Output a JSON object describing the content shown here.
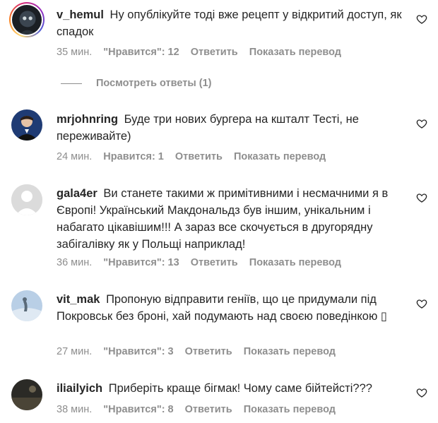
{
  "comments": [
    {
      "username": "v_hemul",
      "text": "Ну опублікуйте тоді вже рецепт у відкритий доступ, як спадок",
      "time": "35 мин.",
      "likes": "\"Нравится\": 12",
      "reply": "Ответить",
      "translate": "Показать перевод",
      "replies": "Посмотреть ответы (1)"
    },
    {
      "username": "mrjohnring",
      "text": "Буде три нових бургера на кшталт Тесті, не переживайте)",
      "time": "24 мин.",
      "likes": "Нравится: 1",
      "reply": "Ответить",
      "translate": "Показать перевод"
    },
    {
      "username": "gala4er",
      "text": "Ви станете такими ж примітивними і несмачними я в Європі! Український Макдональдз був іншим, унікальним і набагато цікавішим!!! А зараз все скочується в другорядну забігалівку як у Польщі наприклад!",
      "time": "36 мин.",
      "likes": "\"Нравится\": 13",
      "reply": "Ответить",
      "translate": "Показать перевод"
    },
    {
      "username": "vit_mak",
      "text": "Пропоную відправити геніїв, що це придумали під Покровськ без броні, хай подумають над своєю поведінкою ▯",
      "time": "27 мин.",
      "likes": "\"Нравится\": 3",
      "reply": "Ответить",
      "translate": "Показать перевод"
    },
    {
      "username": "iliailyich",
      "text": "Приберіть краще бігмак! Чому саме бійтейсті???",
      "time": "38 мин.",
      "likes": "\"Нравится\": 8",
      "reply": "Ответить",
      "translate": "Показать перевод"
    }
  ],
  "colors": {
    "text": "#262626",
    "secondary": "#8e8e8e",
    "background": "#ffffff"
  },
  "icons": {
    "like": "heart-outline-icon"
  }
}
